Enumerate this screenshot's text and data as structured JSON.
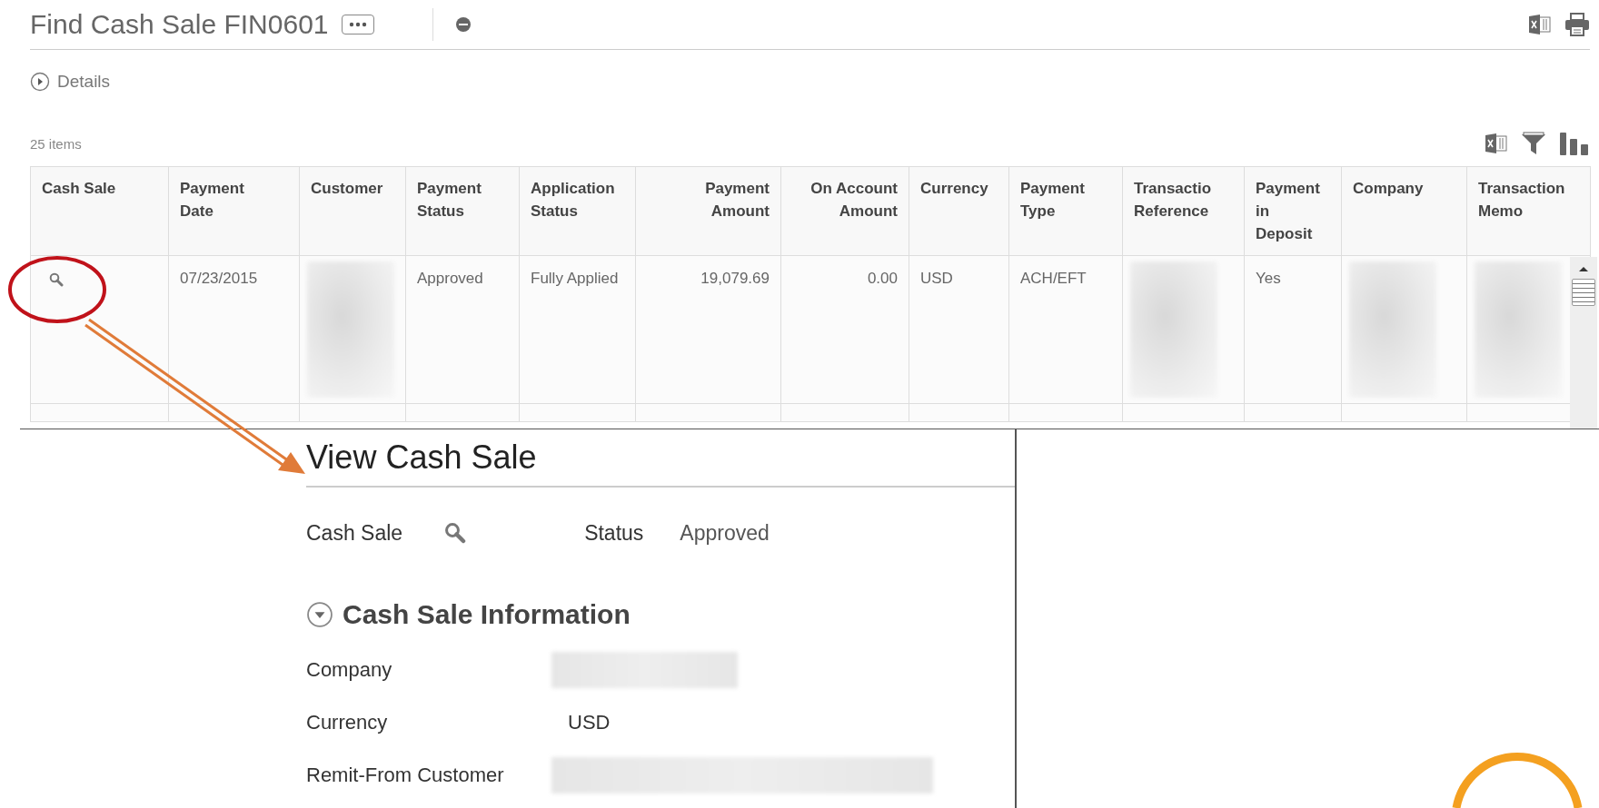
{
  "page_title": "Find Cash Sale FIN0601",
  "details": {
    "label": "Details",
    "expanded": false
  },
  "items_count": "25 items",
  "table": {
    "columns": [
      {
        "label": "Cash Sale",
        "numeric": false
      },
      {
        "label": "Payment\nDate",
        "numeric": false
      },
      {
        "label": "Customer",
        "numeric": false
      },
      {
        "label": "Payment\nStatus",
        "numeric": false
      },
      {
        "label": "Application\nStatus",
        "numeric": false
      },
      {
        "label": "Payment\nAmount",
        "numeric": true
      },
      {
        "label": "On Account\nAmount",
        "numeric": true
      },
      {
        "label": "Currency",
        "numeric": false
      },
      {
        "label": "Payment\nType",
        "numeric": false
      },
      {
        "label": "Transactio\nReference",
        "numeric": false
      },
      {
        "label": "Payment\nin\nDeposit",
        "numeric": false
      },
      {
        "label": "Company",
        "numeric": false
      },
      {
        "label": "Transaction\nMemo",
        "numeric": false
      }
    ],
    "rows": [
      [
        {
          "kind": "search"
        },
        {
          "kind": "text",
          "text": "07/23/2015"
        },
        {
          "kind": "redacted"
        },
        {
          "kind": "text",
          "text": "Approved"
        },
        {
          "kind": "text",
          "text": "Fully Applied"
        },
        {
          "kind": "text",
          "text": "19,079.69"
        },
        {
          "kind": "text",
          "text": "0.00"
        },
        {
          "kind": "text",
          "text": "USD"
        },
        {
          "kind": "text",
          "text": "ACH/EFT"
        },
        {
          "kind": "redacted"
        },
        {
          "kind": "text",
          "text": "Yes"
        },
        {
          "kind": "redacted"
        },
        {
          "kind": "redacted"
        }
      ]
    ]
  },
  "view_panel": {
    "title": "View Cash Sale",
    "cash_sale_label": "Cash Sale",
    "status_label": "Status",
    "status_value": "Approved",
    "section": {
      "title": "Cash Sale Information",
      "expanded": true,
      "fields": [
        {
          "label": "Company",
          "kind": "redacted"
        },
        {
          "label": "Currency",
          "kind": "text",
          "value": "USD"
        },
        {
          "label": "Remit-From Customer",
          "kind": "redacted"
        }
      ]
    }
  }
}
